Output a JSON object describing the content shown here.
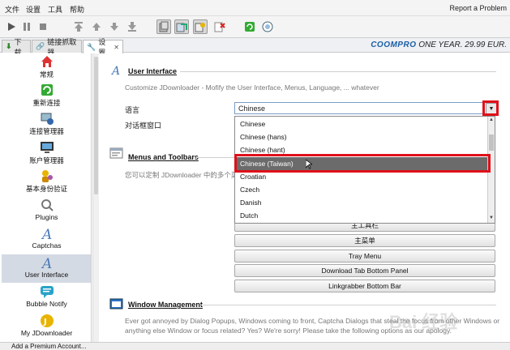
{
  "menubar": {
    "items": [
      "文件",
      "设置",
      "工具",
      "帮助"
    ],
    "report": "Report a Problem"
  },
  "toolbar": {
    "icons": [
      "play-icon",
      "pause-icon",
      "stop-icon",
      "move-top-icon",
      "move-up-icon",
      "move-down-icon",
      "move-bottom-icon",
      "clipboard-observer-icon",
      "auto-reconnect-icon",
      "premium-toggle-icon",
      "silent-mode-icon",
      "reconnect-icon",
      "update-icon"
    ]
  },
  "tabs": [
    {
      "label": "下载"
    },
    {
      "label": "链接抓取器"
    },
    {
      "label": "设置"
    }
  ],
  "promo": {
    "brand": "COOMPRO",
    "text": "ONE YEAR. 29.99 EUR."
  },
  "sidebar": {
    "items": [
      {
        "label": "常规",
        "icon": "home-icon"
      },
      {
        "label": "重新连接",
        "icon": "reconnect-icon"
      },
      {
        "label": "连接管理器",
        "icon": "connection-icon"
      },
      {
        "label": "账户管理器",
        "icon": "account-icon"
      },
      {
        "label": "基本身份验证",
        "icon": "auth-icon"
      },
      {
        "label": "Plugins",
        "icon": "plugins-icon"
      },
      {
        "label": "Captchas",
        "icon": "captcha-icon"
      },
      {
        "label": "User Interface",
        "icon": "ui-icon"
      },
      {
        "label": "Bubble Notify",
        "icon": "bubble-icon"
      },
      {
        "label": "My JDownloader",
        "icon": "myjd-icon"
      }
    ]
  },
  "main": {
    "ui_section": {
      "title": "User Interface",
      "desc": "Customize JDownloader - Mofify the User Interface, Menus, Language, ... whatever",
      "language_label": "语言",
      "language_value": "Chinese",
      "dialog_label": "对话框窗口"
    },
    "menus_section": {
      "title": "Menus and Toolbars",
      "desc": "您可以定制 JDownloader 中的多个菜单"
    },
    "buttons": [
      "主工具栏",
      "主菜单",
      "Tray Menu",
      "Download Tab Bottom Panel",
      "Linkgrabber Bottom Bar"
    ],
    "window_section": {
      "title": "Window Management",
      "desc1": "Ever got annoyed by Dialog Popups, Windows coming to front, Captcha Dialogs that steal the focus from other Windows or",
      "desc2": "anything else Window or focus related? Yes? We're sorry! Please take the following options as our apology."
    },
    "dropdown": {
      "options": [
        "Chinese",
        "Chinese (hans)",
        "Chinese (hant)",
        "Chinese (Taiwan)",
        "Croatian",
        "Czech",
        "Danish",
        "Dutch"
      ],
      "highlighted": "Chinese (Taiwan)"
    }
  },
  "statusbar": {
    "text": "Add a Premium Account..."
  },
  "watermark": "Bai 经验",
  "colors": {
    "highlight_red": "#e0101a",
    "selected_bg": "#6b6b6b",
    "sidebar_selected": "#d4dae3"
  }
}
